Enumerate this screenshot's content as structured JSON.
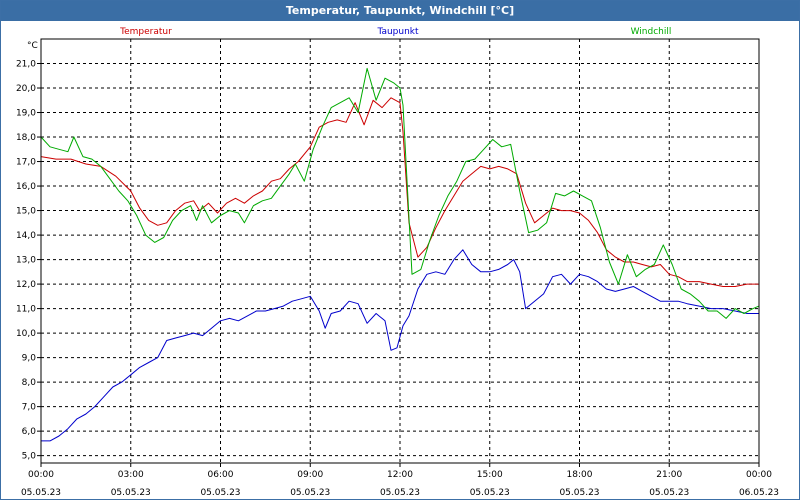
{
  "window": {
    "title": "Temperatur, Taupunkt, Windchill [°C]"
  },
  "chart_data": {
    "type": "line",
    "title": "Temperatur, Taupunkt, Windchill [°C]",
    "ylabel": "°C",
    "ylim": [
      4.7,
      22.0
    ],
    "xlim": [
      0,
      24
    ],
    "yticks": [
      5.0,
      6.0,
      7.0,
      8.0,
      9.0,
      10.0,
      11.0,
      12.0,
      13.0,
      14.0,
      15.0,
      16.0,
      17.0,
      18.0,
      19.0,
      20.0,
      21.0
    ],
    "ytick_labels": [
      "5,0",
      "6,0",
      "7,0",
      "8,0",
      "9,0",
      "10,0",
      "11,0",
      "12,0",
      "13,0",
      "14,0",
      "15,0",
      "16,0",
      "17,0",
      "18,0",
      "19,0",
      "20,0",
      "21,0"
    ],
    "xticks": [
      {
        "x": 0,
        "time": "00:00",
        "date": "05.05.23"
      },
      {
        "x": 3,
        "time": "03:00",
        "date": "05.05.23"
      },
      {
        "x": 6,
        "time": "06:00",
        "date": "05.05.23"
      },
      {
        "x": 9,
        "time": "09:00",
        "date": "05.05.23"
      },
      {
        "x": 12,
        "time": "12:00",
        "date": "05.05.23"
      },
      {
        "x": 15,
        "time": "15:00",
        "date": "05.05.23"
      },
      {
        "x": 18,
        "time": "18:00",
        "date": "05.05.23"
      },
      {
        "x": 21,
        "time": "21:00",
        "date": "05.05.23"
      },
      {
        "x": 24,
        "time": "00:00",
        "date": "06.05.23"
      }
    ],
    "grid": true,
    "legend": "top",
    "series": [
      {
        "name": "Temperatur",
        "color": "#cc0000",
        "legend_pos": "left",
        "points": [
          [
            0,
            17.2
          ],
          [
            0.5,
            17.1
          ],
          [
            1,
            17.1
          ],
          [
            1.5,
            16.9
          ],
          [
            2,
            16.8
          ],
          [
            2.5,
            16.4
          ],
          [
            3,
            15.8
          ],
          [
            3.3,
            15.1
          ],
          [
            3.6,
            14.6
          ],
          [
            3.9,
            14.4
          ],
          [
            4.2,
            14.5
          ],
          [
            4.5,
            15.0
          ],
          [
            4.8,
            15.3
          ],
          [
            5.1,
            15.4
          ],
          [
            5.3,
            15.0
          ],
          [
            5.6,
            15.3
          ],
          [
            5.9,
            14.9
          ],
          [
            6.2,
            15.3
          ],
          [
            6.5,
            15.5
          ],
          [
            6.8,
            15.3
          ],
          [
            7.1,
            15.6
          ],
          [
            7.4,
            15.8
          ],
          [
            7.7,
            16.2
          ],
          [
            8,
            16.3
          ],
          [
            8.3,
            16.7
          ],
          [
            8.6,
            17.0
          ],
          [
            9,
            17.6
          ],
          [
            9.3,
            18.4
          ],
          [
            9.6,
            18.6
          ],
          [
            9.9,
            18.7
          ],
          [
            10.2,
            18.6
          ],
          [
            10.5,
            19.4
          ],
          [
            10.8,
            18.5
          ],
          [
            11.1,
            19.5
          ],
          [
            11.4,
            19.2
          ],
          [
            11.7,
            19.6
          ],
          [
            12,
            19.4
          ],
          [
            12.1,
            18.2
          ],
          [
            12.3,
            14.5
          ],
          [
            12.6,
            13.1
          ],
          [
            12.9,
            13.5
          ],
          [
            13.2,
            14.3
          ],
          [
            13.5,
            15.0
          ],
          [
            13.8,
            15.6
          ],
          [
            14.1,
            16.2
          ],
          [
            14.4,
            16.5
          ],
          [
            14.7,
            16.8
          ],
          [
            15,
            16.7
          ],
          [
            15.3,
            16.8
          ],
          [
            15.6,
            16.7
          ],
          [
            15.9,
            16.5
          ],
          [
            16.2,
            15.3
          ],
          [
            16.5,
            14.5
          ],
          [
            16.8,
            14.8
          ],
          [
            17.1,
            15.1
          ],
          [
            17.4,
            15.0
          ],
          [
            17.7,
            15.0
          ],
          [
            18,
            14.9
          ],
          [
            18.3,
            14.6
          ],
          [
            18.6,
            14.1
          ],
          [
            18.9,
            13.4
          ],
          [
            19.2,
            13.1
          ],
          [
            19.5,
            12.9
          ],
          [
            19.8,
            12.9
          ],
          [
            20.1,
            12.8
          ],
          [
            20.4,
            12.7
          ],
          [
            20.7,
            12.8
          ],
          [
            21,
            12.4
          ],
          [
            21.3,
            12.3
          ],
          [
            21.6,
            12.1
          ],
          [
            22,
            12.1
          ],
          [
            22.4,
            12.0
          ],
          [
            22.8,
            11.9
          ],
          [
            23.2,
            11.9
          ],
          [
            23.6,
            12.0
          ],
          [
            24,
            12.0
          ]
        ]
      },
      {
        "name": "Taupunkt",
        "color": "#0000cc",
        "legend_pos": "center",
        "points": [
          [
            0,
            5.6
          ],
          [
            0.3,
            5.6
          ],
          [
            0.6,
            5.8
          ],
          [
            0.9,
            6.1
          ],
          [
            1.2,
            6.5
          ],
          [
            1.5,
            6.7
          ],
          [
            1.8,
            7.0
          ],
          [
            2.1,
            7.4
          ],
          [
            2.4,
            7.8
          ],
          [
            2.7,
            8.0
          ],
          [
            3,
            8.3
          ],
          [
            3.3,
            8.6
          ],
          [
            3.6,
            8.8
          ],
          [
            3.9,
            9.0
          ],
          [
            4.2,
            9.7
          ],
          [
            4.5,
            9.8
          ],
          [
            4.8,
            9.9
          ],
          [
            5.1,
            10.0
          ],
          [
            5.4,
            9.9
          ],
          [
            5.7,
            10.2
          ],
          [
            6,
            10.5
          ],
          [
            6.3,
            10.6
          ],
          [
            6.6,
            10.5
          ],
          [
            6.9,
            10.7
          ],
          [
            7.2,
            10.9
          ],
          [
            7.5,
            10.9
          ],
          [
            7.8,
            11.0
          ],
          [
            8.1,
            11.1
          ],
          [
            8.4,
            11.3
          ],
          [
            8.7,
            11.4
          ],
          [
            9,
            11.5
          ],
          [
            9.3,
            10.9
          ],
          [
            9.5,
            10.2
          ],
          [
            9.7,
            10.8
          ],
          [
            10,
            10.9
          ],
          [
            10.3,
            11.3
          ],
          [
            10.6,
            11.2
          ],
          [
            10.9,
            10.4
          ],
          [
            11.2,
            10.8
          ],
          [
            11.5,
            10.5
          ],
          [
            11.7,
            9.3
          ],
          [
            11.9,
            9.4
          ],
          [
            12.1,
            10.3
          ],
          [
            12.3,
            10.7
          ],
          [
            12.6,
            11.8
          ],
          [
            12.9,
            12.4
          ],
          [
            13.2,
            12.5
          ],
          [
            13.5,
            12.4
          ],
          [
            13.8,
            13.0
          ],
          [
            14.1,
            13.4
          ],
          [
            14.4,
            12.8
          ],
          [
            14.7,
            12.5
          ],
          [
            15,
            12.5
          ],
          [
            15.3,
            12.6
          ],
          [
            15.6,
            12.8
          ],
          [
            15.8,
            13.0
          ],
          [
            16.0,
            12.5
          ],
          [
            16.2,
            11.0
          ],
          [
            16.5,
            11.3
          ],
          [
            16.8,
            11.6
          ],
          [
            17.1,
            12.3
          ],
          [
            17.4,
            12.4
          ],
          [
            17.7,
            12.0
          ],
          [
            18,
            12.4
          ],
          [
            18.3,
            12.3
          ],
          [
            18.6,
            12.1
          ],
          [
            18.9,
            11.8
          ],
          [
            19.2,
            11.7
          ],
          [
            19.5,
            11.8
          ],
          [
            19.8,
            11.9
          ],
          [
            20.1,
            11.7
          ],
          [
            20.4,
            11.5
          ],
          [
            20.7,
            11.3
          ],
          [
            21,
            11.3
          ],
          [
            21.3,
            11.3
          ],
          [
            21.6,
            11.2
          ],
          [
            22,
            11.1
          ],
          [
            22.4,
            11.0
          ],
          [
            22.8,
            11.0
          ],
          [
            23.2,
            10.9
          ],
          [
            23.6,
            10.8
          ],
          [
            24,
            10.8
          ]
        ]
      },
      {
        "name": "Windchill",
        "color": "#00aa00",
        "legend_pos": "right",
        "points": [
          [
            0,
            18.0
          ],
          [
            0.3,
            17.6
          ],
          [
            0.6,
            17.5
          ],
          [
            0.9,
            17.4
          ],
          [
            1.1,
            18.0
          ],
          [
            1.4,
            17.2
          ],
          [
            1.7,
            17.1
          ],
          [
            2,
            16.8
          ],
          [
            2.3,
            16.3
          ],
          [
            2.6,
            15.8
          ],
          [
            2.9,
            15.4
          ],
          [
            3.2,
            14.8
          ],
          [
            3.5,
            14.0
          ],
          [
            3.8,
            13.7
          ],
          [
            4.1,
            13.9
          ],
          [
            4.4,
            14.6
          ],
          [
            4.7,
            15.0
          ],
          [
            5,
            15.2
          ],
          [
            5.2,
            14.6
          ],
          [
            5.4,
            15.2
          ],
          [
            5.7,
            14.5
          ],
          [
            6,
            14.8
          ],
          [
            6.3,
            15.0
          ],
          [
            6.6,
            14.9
          ],
          [
            6.8,
            14.5
          ],
          [
            7.1,
            15.2
          ],
          [
            7.4,
            15.4
          ],
          [
            7.7,
            15.5
          ],
          [
            8,
            16.0
          ],
          [
            8.3,
            16.5
          ],
          [
            8.5,
            16.9
          ],
          [
            8.8,
            16.2
          ],
          [
            9.1,
            17.5
          ],
          [
            9.4,
            18.4
          ],
          [
            9.7,
            19.2
          ],
          [
            10,
            19.4
          ],
          [
            10.3,
            19.6
          ],
          [
            10.6,
            19.0
          ],
          [
            10.9,
            20.8
          ],
          [
            11.2,
            19.5
          ],
          [
            11.5,
            20.4
          ],
          [
            11.8,
            20.2
          ],
          [
            12,
            20.0
          ],
          [
            12.1,
            19.3
          ],
          [
            12.4,
            12.4
          ],
          [
            12.7,
            12.6
          ],
          [
            13,
            13.8
          ],
          [
            13.3,
            14.8
          ],
          [
            13.6,
            15.6
          ],
          [
            13.9,
            16.2
          ],
          [
            14.2,
            17.0
          ],
          [
            14.5,
            17.1
          ],
          [
            14.8,
            17.5
          ],
          [
            15.1,
            17.9
          ],
          [
            15.4,
            17.6
          ],
          [
            15.7,
            17.7
          ],
          [
            16,
            15.8
          ],
          [
            16.3,
            14.1
          ],
          [
            16.6,
            14.2
          ],
          [
            16.9,
            14.5
          ],
          [
            17.2,
            15.7
          ],
          [
            17.5,
            15.6
          ],
          [
            17.8,
            15.8
          ],
          [
            18.1,
            15.6
          ],
          [
            18.4,
            15.4
          ],
          [
            18.7,
            14.3
          ],
          [
            19,
            12.9
          ],
          [
            19.3,
            12.0
          ],
          [
            19.6,
            13.2
          ],
          [
            19.9,
            12.3
          ],
          [
            20.2,
            12.6
          ],
          [
            20.5,
            12.8
          ],
          [
            20.8,
            13.6
          ],
          [
            21.1,
            12.8
          ],
          [
            21.4,
            11.8
          ],
          [
            21.7,
            11.6
          ],
          [
            22,
            11.3
          ],
          [
            22.3,
            10.9
          ],
          [
            22.6,
            10.9
          ],
          [
            22.9,
            10.6
          ],
          [
            23.2,
            11.0
          ],
          [
            23.5,
            10.8
          ],
          [
            23.8,
            11.0
          ],
          [
            24,
            11.1
          ]
        ]
      }
    ]
  }
}
